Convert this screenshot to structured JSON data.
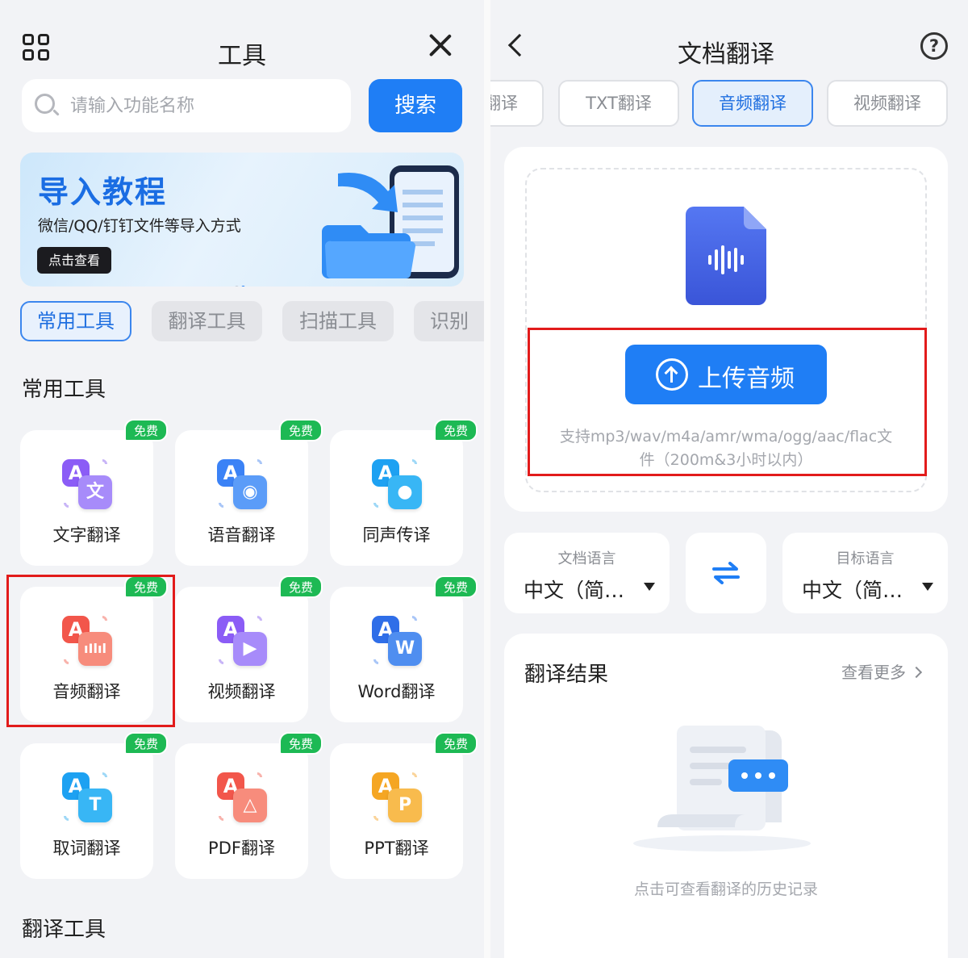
{
  "left": {
    "header": {
      "title": "工具"
    },
    "search": {
      "placeholder": "请输入功能名称",
      "button_label": "搜索"
    },
    "banner": {
      "title": "导入教程",
      "subtitle": "微信/QQ/钉钉文件等导入方式",
      "button_label": "点击查看"
    },
    "category_tabs": [
      "常用工具",
      "翻译工具",
      "扫描工具",
      "识别"
    ],
    "active_category": "常用工具",
    "section_title": "常用工具",
    "badge_label": "免费",
    "tools": [
      {
        "label": "文字翻译",
        "icon": "text-translate-icon",
        "color": "#8b5cf6"
      },
      {
        "label": "语音翻译",
        "icon": "voice-translate-icon",
        "color": "#3b82f6"
      },
      {
        "label": "同声传译",
        "icon": "simultaneous-interpret-icon",
        "color": "#1da1f2"
      },
      {
        "label": "音频翻译",
        "icon": "audio-translate-icon",
        "color": "#f2564b"
      },
      {
        "label": "视频翻译",
        "icon": "video-translate-icon",
        "color": "#8b5cf6"
      },
      {
        "label": "Word翻译",
        "icon": "word-translate-icon",
        "color": "#2f6ee8"
      },
      {
        "label": "取词翻译",
        "icon": "word-pick-translate-icon",
        "color": "#1da1f2"
      },
      {
        "label": "PDF翻译",
        "icon": "pdf-translate-icon",
        "color": "#f2564b"
      },
      {
        "label": "PPT翻译",
        "icon": "ppt-translate-icon",
        "color": "#f5a623"
      }
    ],
    "next_section_title": "翻译工具"
  },
  "right": {
    "header": {
      "title": "文档翻译"
    },
    "type_tabs": [
      "翻译",
      "TXT翻译",
      "音频翻译",
      "视频翻译"
    ],
    "active_type": "音频翻译",
    "upload": {
      "button_label": "上传音频",
      "hint_line1": "支持mp3/wav/m4a/amr/wma/ogg/aac/flac文",
      "hint_line2": "件（200m&3小时以内）"
    },
    "source_language": {
      "caption": "文档语言",
      "value": "中文（简…"
    },
    "target_language": {
      "caption": "目标语言",
      "value": "中文（简…"
    },
    "result": {
      "title": "翻译结果",
      "more_label": "查看更多",
      "empty_text": "点击可查看翻译的历史记录"
    }
  },
  "colors": {
    "accent": "#1f7ef5",
    "badge": "#1db954",
    "highlight": "#e21b1b",
    "background": "#f2f3f6"
  }
}
